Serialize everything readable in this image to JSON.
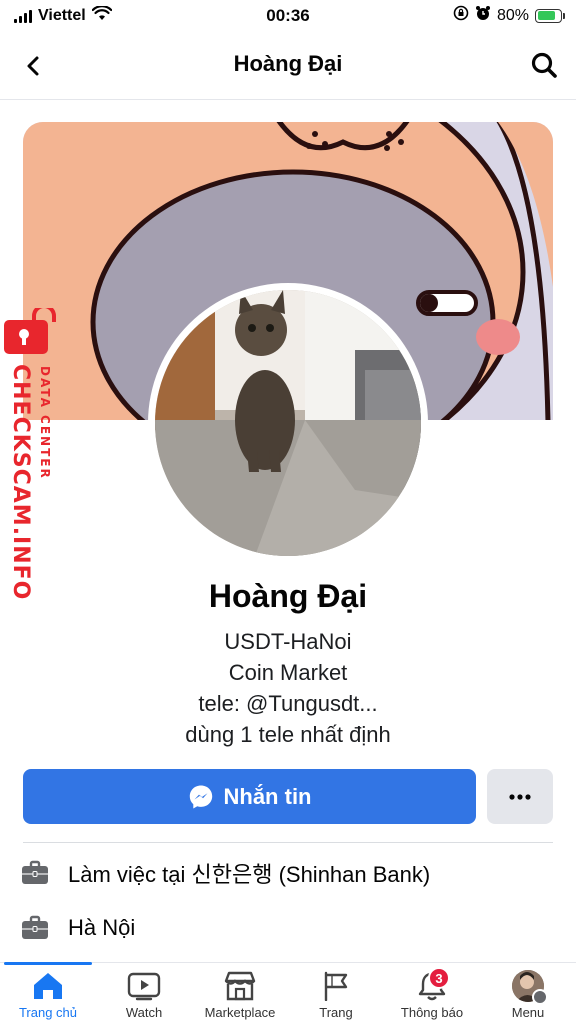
{
  "status_bar": {
    "carrier": "Viettel",
    "time": "00:36",
    "battery_percent": "80%",
    "battery_level": 0.8
  },
  "header": {
    "title": "Hoàng Đại",
    "back_icon": "chevron-left-icon",
    "search_icon": "search-icon"
  },
  "watermark": {
    "text": "CHECKSCAM.INFO",
    "subtitle": "DATA CENTER"
  },
  "profile": {
    "name": "Hoàng Đại",
    "bio": [
      "USDT-HaNoi",
      "Coin Market",
      "tele: @Tungusdt...",
      "dùng 1 tele nhất định"
    ]
  },
  "actions": {
    "message_label": "Nhắn tin",
    "more_icon": "more-dots-icon"
  },
  "details": [
    {
      "icon": "briefcase-icon",
      "text": "Làm việc tại 신한은행 (Shinhan Bank)"
    },
    {
      "icon": "briefcase-icon",
      "text": "Hà Nội"
    }
  ],
  "tab_bar": {
    "tabs": [
      {
        "label": "Trang chủ",
        "icon": "home-icon",
        "active": true
      },
      {
        "label": "Watch",
        "icon": "watch-icon"
      },
      {
        "label": "Marketplace",
        "icon": "marketplace-icon"
      },
      {
        "label": "Trang",
        "icon": "flag-icon"
      },
      {
        "label": "Thông báo",
        "icon": "bell-icon",
        "badge": "3"
      },
      {
        "label": "Menu",
        "icon": "menu-avatar-icon"
      }
    ]
  },
  "colors": {
    "accent": "#1877f2",
    "message_button": "#3275e4",
    "badge": "#e41e3f",
    "watermark": "#e8262d"
  }
}
